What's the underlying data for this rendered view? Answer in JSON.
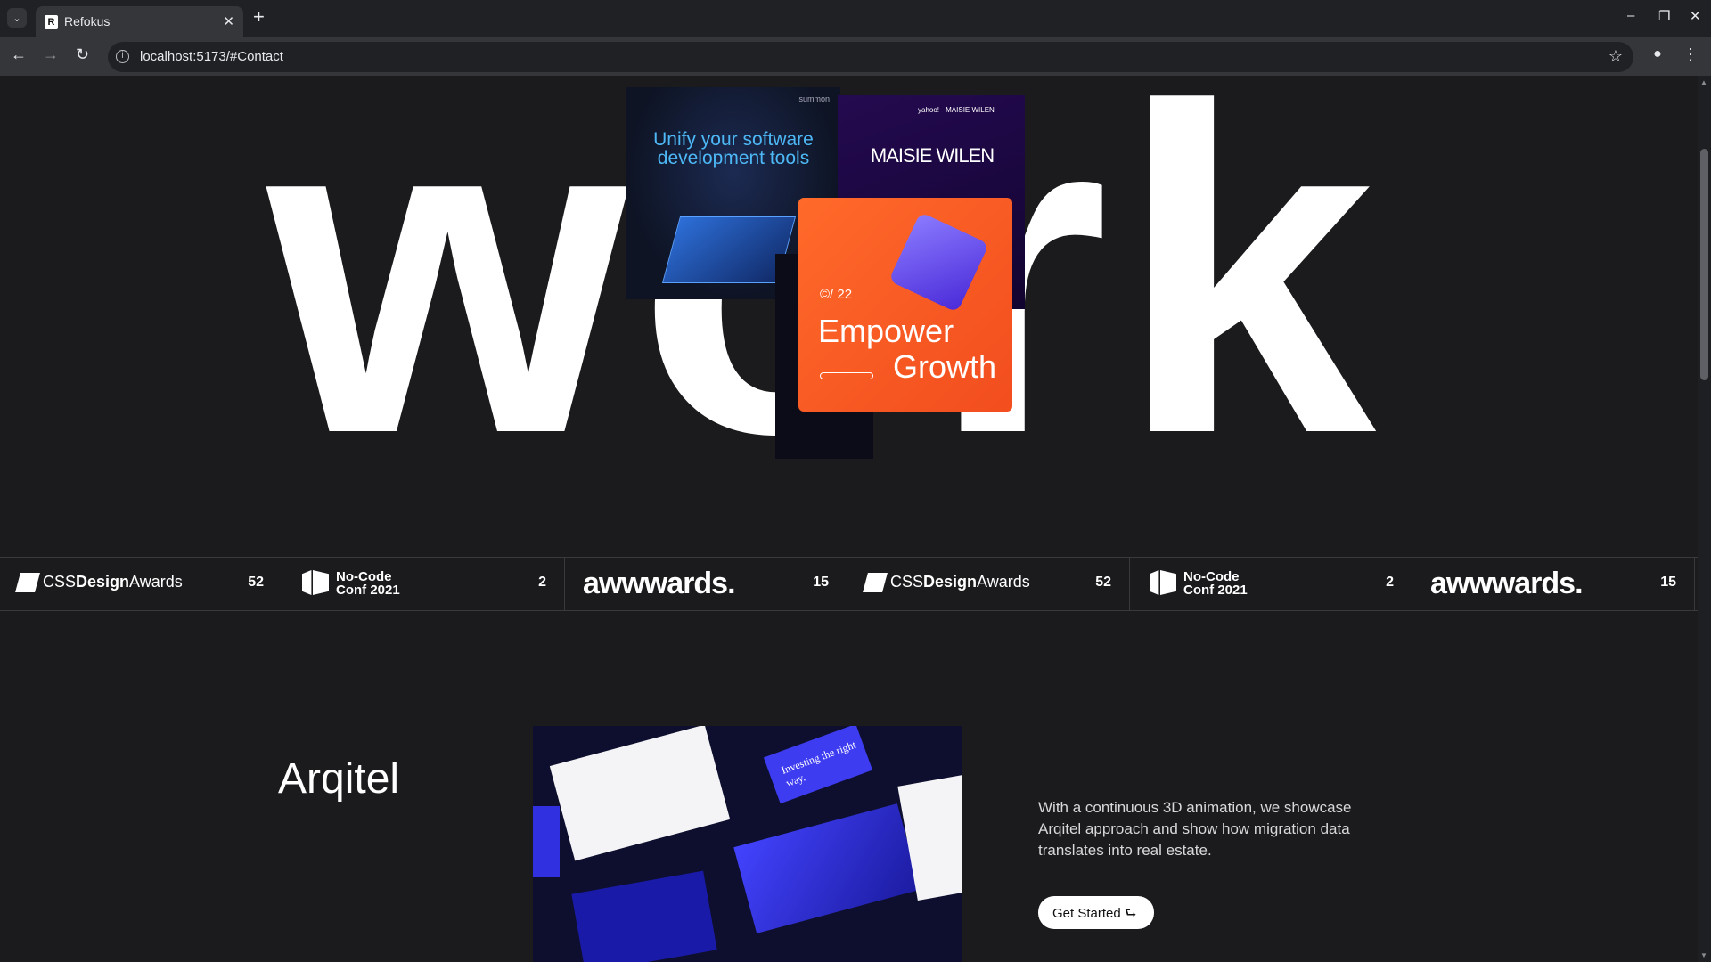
{
  "browser": {
    "tab_title": "Refokus",
    "tab_favicon": "R",
    "url": "localhost:5173/#Contact"
  },
  "hero": {
    "word": "work",
    "card_software": {
      "logo": "summon",
      "title": "Unify your software development tools"
    },
    "card_maisie": {
      "brand": "yahoo! · MAISIE WILEN",
      "title": "MAISIE WILEN"
    },
    "card_orange": {
      "number": "©/ 22",
      "title_line1": "Empower",
      "title_line2": "Growth"
    }
  },
  "awards": [
    {
      "name_prefix": "CSS",
      "name_bold": "Design",
      "name_suffix": "Awards",
      "count": "52",
      "kind": "css"
    },
    {
      "name_line1": "No-Code",
      "name_line2": "Conf 2021",
      "count": "2",
      "kind": "nc"
    },
    {
      "name": "awwwards.",
      "count": "15",
      "kind": "aw"
    },
    {
      "name_prefix": "CSS",
      "name_bold": "Design",
      "name_suffix": "Awards",
      "count": "52",
      "kind": "css"
    },
    {
      "name_line1": "No-Code",
      "name_line2": "Conf 2021",
      "count": "2",
      "kind": "nc"
    },
    {
      "name": "awwwards.",
      "count": "15",
      "kind": "aw"
    }
  ],
  "project": {
    "title": "Arqitel",
    "image_caption": "Investing the right way.",
    "description": "With a continuous 3D animation, we showcase Arqitel approach and show how migration data translates into real estate.",
    "cta": "Get Started ⮑"
  }
}
